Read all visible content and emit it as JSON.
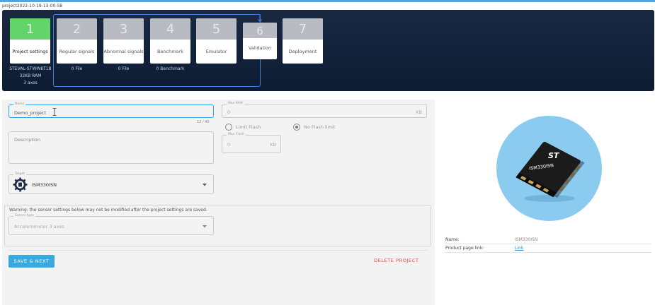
{
  "project": {
    "title": "project2022-10-19-13-00-58"
  },
  "stepper": {
    "steps": [
      {
        "num": "1",
        "label": "Project settings"
      },
      {
        "num": "2",
        "label": "Regular signals"
      },
      {
        "num": "3",
        "label": "Abnormal signals"
      },
      {
        "num": "4",
        "label": "Benchmark"
      },
      {
        "num": "5",
        "label": "Emulator"
      },
      {
        "num": "6",
        "label": "Validation"
      },
      {
        "num": "7",
        "label": "Deployment"
      }
    ],
    "board": {
      "line1": "STEVAL-STWINKT1B",
      "line2": "32KB RAM",
      "line3": "3 axes"
    },
    "regular_count": "0 File",
    "abnormal_count": "0 File",
    "benchmark_count": "0 Benchmark"
  },
  "form": {
    "name": {
      "label": "Name",
      "value": "Demo_project",
      "counter": "12 / 40"
    },
    "max_ram": {
      "label": "Max RAM",
      "value": "0",
      "unit": "KB"
    },
    "radios": {
      "limit_flash": "Limit Flash",
      "no_flash": "No Flash limit",
      "selected": "no_flash"
    },
    "description": {
      "label": "Description"
    },
    "max_flash": {
      "label": "Max Flash",
      "value": "0",
      "unit": "KB"
    },
    "target": {
      "label": "Target",
      "value": "ISM330ISN"
    },
    "warning": "Warning: the sensor settings below may not be modified after the project settings are saved.",
    "sensor_type": {
      "label": "Sensor type",
      "value": "Accelerometer 3 axes"
    },
    "save_label": "SAVE & NEXT",
    "delete_label": "DELETE PROJECT"
  },
  "product": {
    "chip_brand": "ST",
    "chip_text": "ISM330ISN",
    "name_key": "Name:",
    "name_value": "ISM330ISN",
    "link_key": "Product page link:",
    "link_value": "Link"
  },
  "colors": {
    "accent": "#39a9e0",
    "active_step": "#63d36c",
    "delete": "#d04b3f",
    "banner": "#0d1b33"
  }
}
